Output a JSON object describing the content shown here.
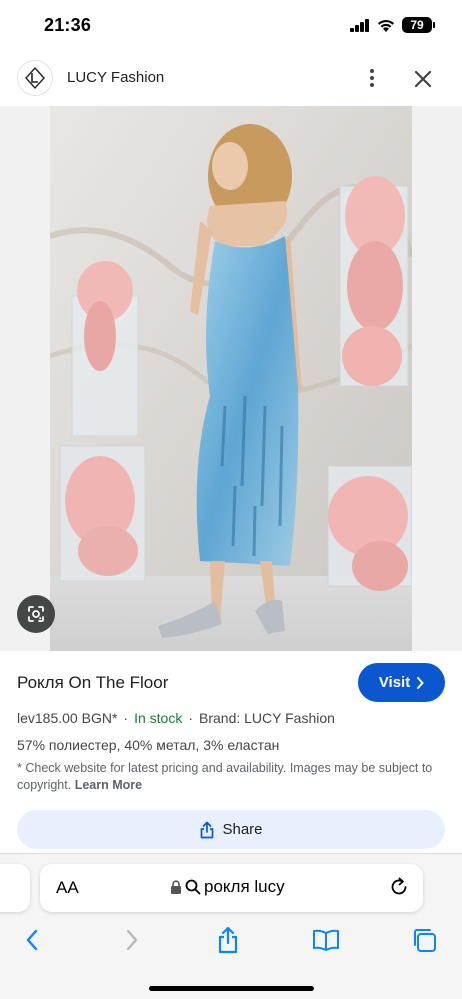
{
  "status_bar": {
    "time": "21:36",
    "battery": "79"
  },
  "header": {
    "brand_name": "LUCY Fashion",
    "logo_icon": "lucy-logo-icon",
    "more_icon": "more-vert-icon",
    "close_icon": "close-icon"
  },
  "image": {
    "lens_icon": "google-lens-icon"
  },
  "product": {
    "title": "Рокля On The Floor",
    "visit_label": "Visit",
    "price": "lev185.00 BGN*",
    "stock": "In stock",
    "brand": "Brand: LUCY Fashion",
    "material": "57% полиестер, 40% метал, 3% еластан",
    "disclaimer": "* Check website for latest pricing and availability. Images may be subject to copyright.",
    "learn_more": "Learn More",
    "share_label": "Share"
  },
  "browser": {
    "aa_label": "AA",
    "address_text": "рокля lucy",
    "icons": [
      "back-icon",
      "forward-icon",
      "share-icon",
      "bookmarks-icon",
      "tabs-icon"
    ]
  },
  "colors": {
    "accent": "#0b57d0",
    "stock_green": "#188038",
    "share_bg": "#e8f0fe"
  }
}
